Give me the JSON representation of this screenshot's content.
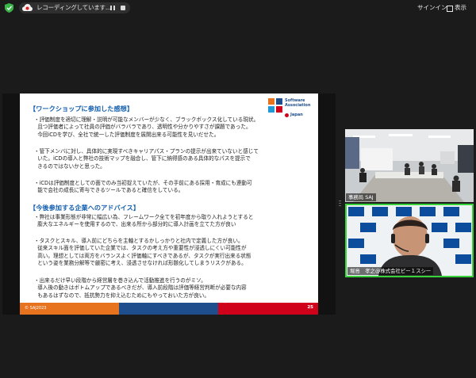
{
  "topbar": {
    "recording_text": "レコーディングしています...",
    "signin_label": "サインイン",
    "view_label": "表示"
  },
  "slide": {
    "logo_text": "Software\nAssociation",
    "logo_japan": "Japan",
    "section1_title": "【ワークショップに参加した感想】",
    "section1_paragraphs": [
      "・評価制度を適切に理解・説明が可能なメンバーが少なく、ブラックボックス化している現状。\n  且つ評価者によって社員の評価がバラバラであり、透明性や分かりやすさが課題であった。\n  今回iCDを学び、全社で統一した評価制度を展開出来る可能性を見いだせた。",
      "・管下メンバに対し、具体的に実現すべきキャリアパス・プランの提示が出来ていないと感じて\n  いた。iCDの導入と弊社の技術マップを融合し、管下に納得感のある具体的なパスを提示で\n  きるのではないかと思った。",
      "・iCDは評価制度としての面でのみ当初捉えていたが、その手前にある採用・育成にも連動可\n  能で会社の成長に寄与できるツールであると確信をしている。"
    ],
    "section2_title": "【今後参加する企業へのアドバイス】",
    "section2_paragraphs": [
      "・弊社は事業形態が非常に幅広い為、フレームワーク全てを初年度から取り入れようとすると\n  膨大なエネルギーを使用するので、出来る所から部分的に導入計画を立てた方が良い",
      "・タスクとスキル、導入前にどちらを主軸とするかしっかりと社内で定義した方が良い。\n  従来スキル面を評価していた企業では、タスクの考え方や重要性が浸透しにくい可能性が\n  高い。理想としては両方をバランスよく評価軸にすべきであるが、タスクが実行出来る状態\n  という姿を業務分解等で厳密に考え、浸透させなければ形骸化してしまうリスクがある。",
      "・出来るだけ早い段階から経営層を巻き込んで活動推進を行うのがミソ。\n  導入後の動きはボトムアップであるべきだが、導入前段階は評価等経営判断が必要な内容\n  もあるはずなので、抵抗勢力を抑え込むためにもやっておいた方が良い。"
    ],
    "footer_copyright": "© SAJ2023",
    "page_number": "25"
  },
  "participants": [
    {
      "name": "事務局 SAJ"
    },
    {
      "name": "堀島　孝之@株式会社ピー１スシー"
    }
  ],
  "colors": {
    "heading": "#1560b0",
    "footer_orange": "#e8731e",
    "footer_blue": "#1f4e8c",
    "footer_red": "#d0021b",
    "active_speaker": "#37d33a"
  }
}
